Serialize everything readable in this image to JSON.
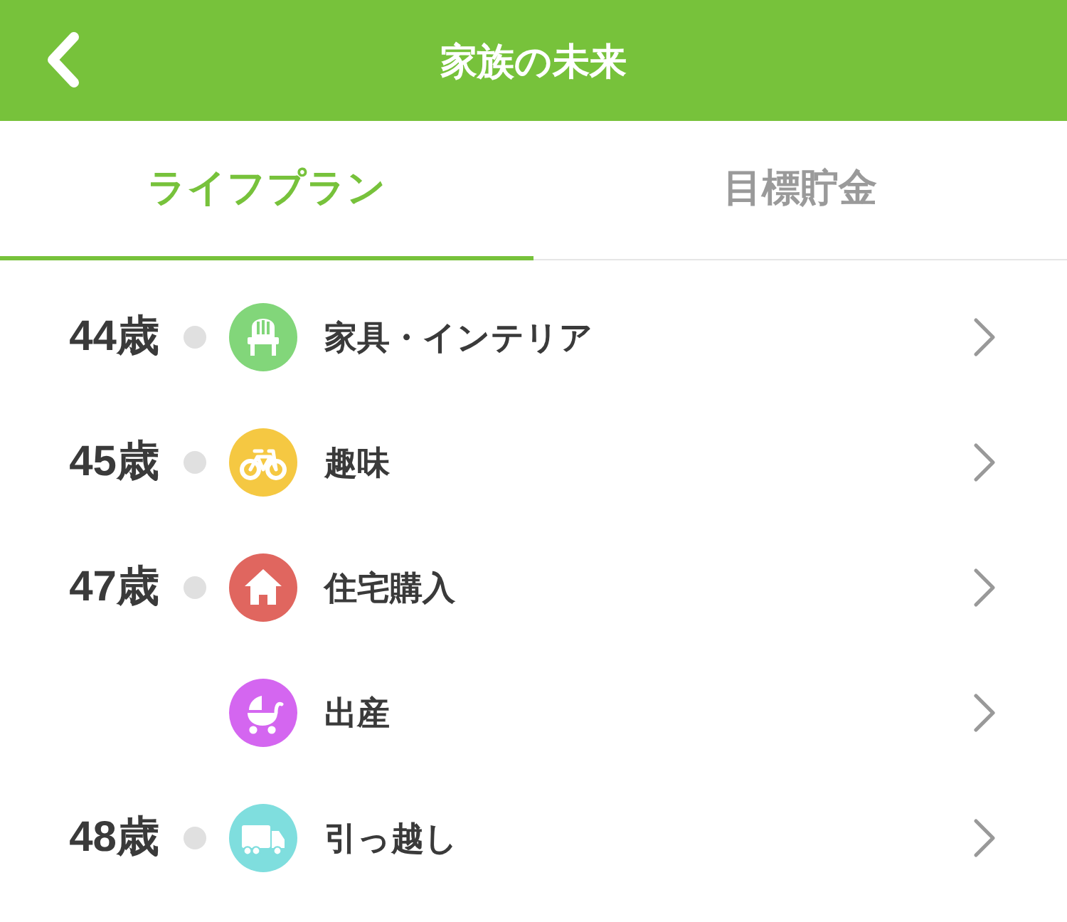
{
  "header": {
    "title": "家族の未来"
  },
  "tabs": [
    {
      "label": "ライフプラン",
      "selected": true
    },
    {
      "label": "目標貯金",
      "selected": false
    }
  ],
  "plan_items": [
    {
      "age": "44歳",
      "kind": "chair",
      "color": "#82d67a",
      "label": "家具・インテリア"
    },
    {
      "age": "45歳",
      "kind": "bicycle",
      "color": "#f5c842",
      "label": "趣味"
    },
    {
      "age": "47歳",
      "kind": "house",
      "color": "#e0665f",
      "label": "住宅購入"
    },
    {
      "kind": "stroller",
      "color": "#d466f0",
      "label": "出産"
    },
    {
      "age": "48歳",
      "kind": "truck",
      "color": "#7fdede",
      "label": "引っ越し"
    }
  ]
}
